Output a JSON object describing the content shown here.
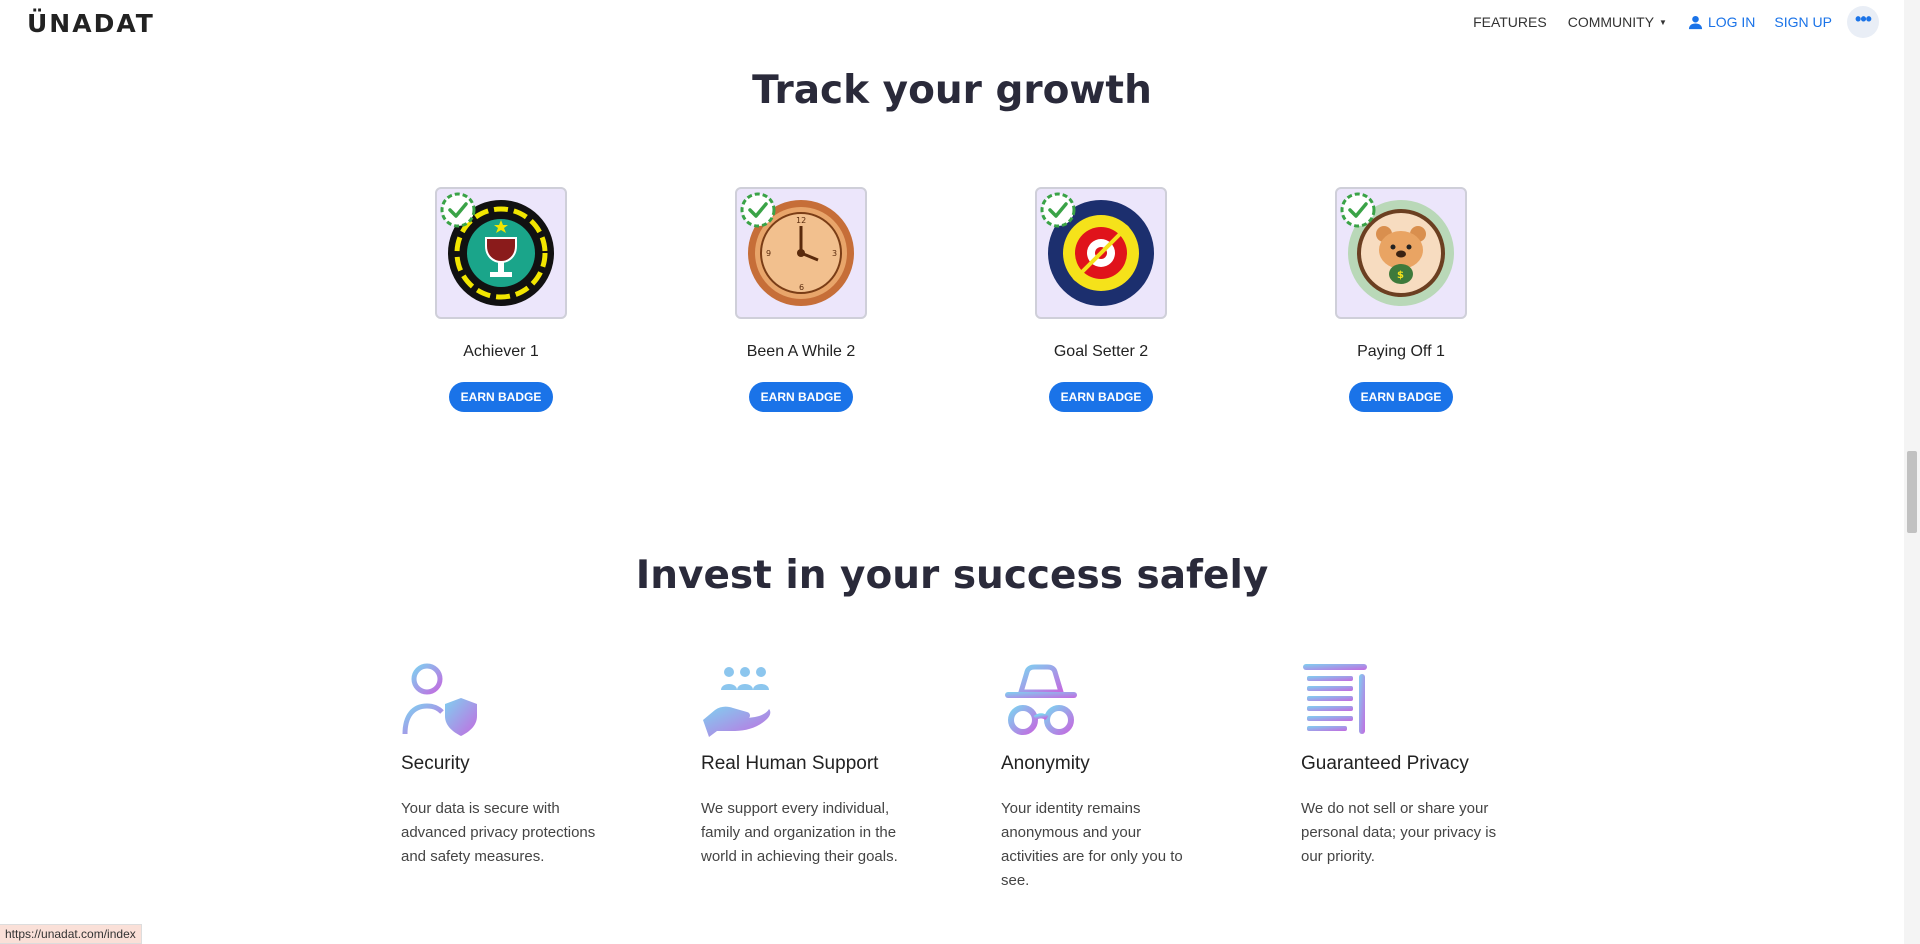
{
  "header": {
    "logo": "ÜNADAT",
    "nav": {
      "features": "FEATURES",
      "community": "COMMUNITY",
      "login": "LOG IN",
      "signup": "SIGN UP"
    }
  },
  "growth": {
    "title": "Track your growth",
    "badges": [
      {
        "name": "Achiever 1",
        "button": "EARN BADGE",
        "icon": "trophy-badge-icon"
      },
      {
        "name": "Been A While 2",
        "button": "EARN BADGE",
        "icon": "clock-badge-icon"
      },
      {
        "name": "Goal Setter 2",
        "button": "EARN BADGE",
        "icon": "target-badge-icon"
      },
      {
        "name": "Paying Off 1",
        "button": "EARN BADGE",
        "icon": "bear-money-badge-icon"
      }
    ]
  },
  "invest": {
    "title": "Invest in your success safely",
    "features": [
      {
        "title": "Security",
        "desc": "Your data is secure with advanced privacy protections and safety measures.",
        "icon": "user-shield-icon"
      },
      {
        "title": "Real Human Support",
        "desc": "We support every individual, family and organization in the world in achieving their goals.",
        "icon": "hand-people-icon"
      },
      {
        "title": "Anonymity",
        "desc": "Your identity remains anonymous and your activities are for only you to see.",
        "icon": "incognito-icon"
      },
      {
        "title": "Guaranteed Privacy",
        "desc": "We do not sell or share your personal data; your privacy is our priority.",
        "icon": "document-list-icon"
      }
    ]
  },
  "status_bar": {
    "url": "https://unadat.com/index"
  },
  "colors": {
    "accent": "#1a73e8",
    "badge_bg": "#ece6fb",
    "check": "#3aa347"
  }
}
